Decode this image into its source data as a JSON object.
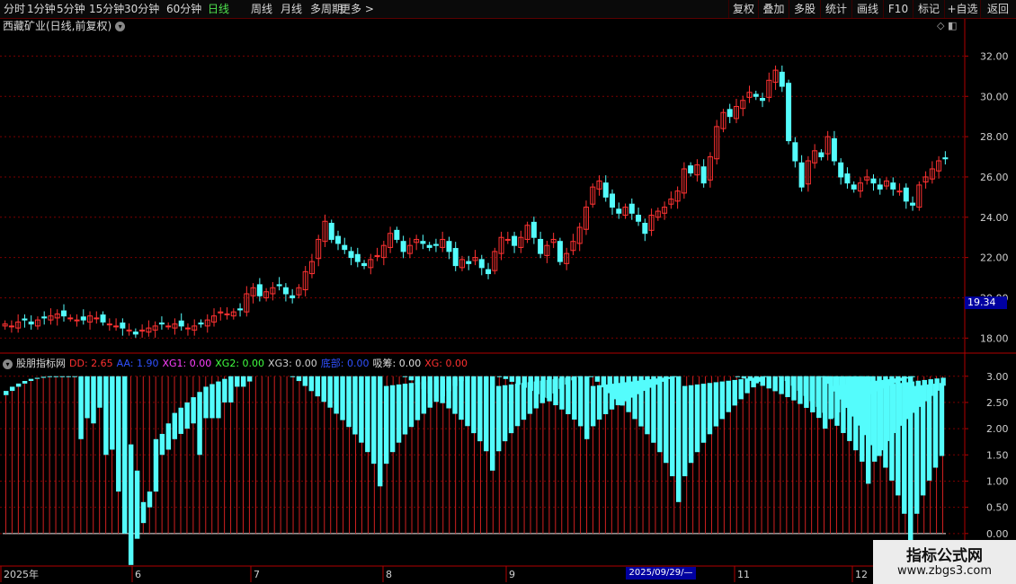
{
  "toolbar": {
    "periods": [
      "分时",
      "1分钟",
      "5分钟",
      "15分钟",
      "30分钟",
      "60分钟",
      "日线",
      "周线",
      "月线",
      "多周期",
      "更多 >"
    ],
    "active_period": "日线",
    "right_buttons": [
      "复权",
      "叠加",
      "多股",
      "统计",
      "画线",
      "F10",
      "标记",
      "+自选",
      "返回"
    ]
  },
  "chart_title": "西藏矿业(日线,前复权)",
  "price_badge": "19.34",
  "date_badge": "2025/09/29/—",
  "indicator": {
    "name": "股朋指标网",
    "values": [
      {
        "label": "DD: 2.65",
        "color": "#ff3030"
      },
      {
        "label": "AA: 1.90",
        "color": "#3050ff"
      },
      {
        "label": "XG1: 0.00",
        "color": "#ff40ff"
      },
      {
        "label": "XG2: 0.00",
        "color": "#40ff40"
      },
      {
        "label": "XG3: 0.00",
        "color": "#d0d0d0"
      },
      {
        "label": "底部: 0.00",
        "color": "#3050ff"
      },
      {
        "label": "吸筹: 0.00",
        "color": "#e0e0e0"
      },
      {
        "label": "XG: 0.00",
        "color": "#ff3030"
      }
    ]
  },
  "watermark": {
    "line1": "指标公式网",
    "line2": "www.zbgs3.com"
  },
  "colors": {
    "up": "#ff3232",
    "down": "#54fcfc",
    "grid": "#7a0000",
    "axis": "#b00000"
  },
  "chart_data": [
    {
      "type": "candlestick",
      "price_ticks": [
        "32.00",
        "30.00",
        "28.00",
        "26.00",
        "24.00",
        "22.00",
        "20.00",
        "18.00"
      ],
      "ylim": [
        17.3,
        33.0
      ],
      "x_labels": [
        "2025年",
        "6",
        "7",
        "8",
        "9",
        "11",
        "12"
      ],
      "close": [
        18.7,
        18.6,
        18.8,
        18.9,
        18.7,
        18.9,
        19.0,
        19.1,
        19.2,
        19.1,
        19.0,
        18.9,
        18.9,
        19.1,
        19.0,
        18.8,
        18.7,
        18.6,
        18.5,
        18.4,
        18.2,
        18.4,
        18.5,
        18.6,
        18.7,
        18.6,
        18.7,
        18.6,
        18.5,
        18.6,
        18.7,
        18.9,
        19.1,
        19.3,
        19.2,
        19.3,
        19.4,
        20.2,
        20.5,
        20.1,
        20.3,
        20.5,
        20.6,
        20.2,
        20.0,
        20.5,
        21.3,
        21.8,
        22.9,
        23.8,
        22.9,
        22.7,
        22.4,
        22.0,
        21.8,
        21.6,
        21.9,
        22.1,
        22.6,
        23.2,
        22.9,
        22.3,
        22.6,
        22.9,
        22.7,
        22.5,
        22.6,
        22.9,
        22.3,
        21.6,
        21.9,
        21.7,
        22.0,
        21.5,
        21.2,
        22.3,
        23.0,
        22.9,
        22.6,
        23.0,
        23.6,
        23.0,
        22.2,
        22.6,
        22.9,
        21.8,
        22.2,
        22.8,
        23.5,
        24.5,
        25.5,
        25.8,
        25.0,
        24.5,
        24.2,
        24.5,
        24.2,
        23.8,
        23.2,
        24.1,
        24.3,
        24.5,
        24.9,
        25.3,
        26.4,
        26.2,
        26.6,
        25.7,
        27.0,
        28.5,
        29.2,
        29.0,
        29.5,
        29.8,
        30.2,
        30.0,
        29.8,
        30.8,
        31.3,
        30.5,
        27.8,
        26.8,
        25.5,
        26.8,
        27.3,
        27.0,
        28.0,
        26.8,
        26.0,
        25.7,
        25.4,
        25.7,
        26.0,
        25.7,
        25.4,
        25.8,
        25.4,
        25.3,
        24.8,
        24.6,
        25.6,
        26.0,
        26.4,
        26.8,
        26.9
      ]
    },
    {
      "type": "bar",
      "ylabels": [
        "3.00",
        "2.50",
        "2.00",
        "1.50",
        "1.00",
        "0.50",
        "0.00"
      ],
      "ylim": [
        -0.62,
        3.15
      ],
      "red_bars": [
        2.64,
        2.72,
        2.8,
        2.86,
        2.91,
        2.95,
        2.97,
        2.99,
        3.0,
        3.0,
        3.0,
        3.0,
        3.0,
        3.0,
        3.0,
        3.0,
        3.0,
        3.0,
        3.0,
        3.0,
        3.0,
        3.0,
        3.0,
        3.0,
        3.0,
        3.0,
        3.0,
        3.0,
        3.0,
        3.0,
        3.0,
        3.0,
        3.0,
        3.0,
        3.0,
        3.0,
        3.0,
        3.0,
        3.0,
        3.0,
        3.0,
        3.0,
        3.0,
        3.0,
        3.0,
        3.0,
        3.0,
        3.0,
        3.0,
        3.0,
        3.0,
        3.0,
        3.0,
        3.0,
        3.0,
        3.0,
        3.0,
        3.0,
        3.0,
        3.0,
        3.0,
        3.0,
        3.0,
        3.0,
        3.0,
        3.0,
        3.0,
        3.0,
        3.0,
        3.0,
        3.0,
        3.0,
        3.0,
        3.0,
        3.0,
        3.0,
        3.0,
        3.0,
        3.0,
        3.0,
        3.0,
        3.0,
        3.0,
        3.0,
        3.0,
        3.0,
        3.0,
        3.0,
        3.0,
        3.0,
        3.0,
        3.0,
        3.0,
        3.0,
        3.0,
        3.0,
        3.0,
        3.0,
        3.0,
        3.0,
        3.0,
        3.0,
        3.0,
        3.0,
        3.0,
        3.0,
        3.0,
        3.0,
        3.0,
        3.0,
        3.0,
        3.0,
        3.0,
        3.0,
        3.0,
        3.0,
        3.0,
        3.0,
        3.0,
        3.0,
        3.0,
        3.0,
        3.0,
        3.0,
        3.0,
        3.0,
        3.0,
        3.0,
        3.0,
        3.0,
        3.0,
        3.0,
        3.0,
        3.0,
        3.0,
        3.0,
        3.0,
        3.0,
        3.0,
        3.0,
        3.0,
        3.0,
        3.0,
        3.0,
        3.0,
        3.0,
        3.0,
        3.0,
        3.0,
        3.0,
        3.0
      ],
      "cyan_bars": [
        [
          2.64,
          2.72
        ],
        [
          2.72,
          2.8
        ],
        [
          2.8,
          2.86
        ],
        [
          2.86,
          2.91
        ],
        [
          2.91,
          2.95
        ],
        [
          2.95,
          2.97
        ],
        [
          2.97,
          2.99
        ],
        [
          2.99,
          3.0
        ],
        [
          3.0,
          3.0
        ],
        [
          3.0,
          3.0
        ],
        [
          3.0,
          3.0
        ],
        [
          3.0,
          3.0
        ],
        [
          3.0,
          1.8
        ],
        [
          3.0,
          2.2
        ],
        [
          3.0,
          2.1
        ],
        [
          3.0,
          2.4
        ],
        [
          3.0,
          1.5
        ],
        [
          3.0,
          1.6
        ],
        [
          3.0,
          0.8
        ],
        [
          3.0,
          0.0
        ],
        [
          1.7,
          -0.6
        ],
        [
          1.2,
          -0.1
        ],
        [
          0.6,
          0.2
        ],
        [
          0.8,
          0.5
        ],
        [
          1.8,
          0.8
        ],
        [
          1.9,
          1.5
        ],
        [
          2.1,
          1.6
        ],
        [
          2.3,
          1.8
        ],
        [
          2.4,
          1.9
        ],
        [
          2.5,
          2.0
        ],
        [
          2.6,
          2.1
        ],
        [
          2.7,
          1.5
        ],
        [
          2.8,
          2.2
        ],
        [
          2.85,
          2.2
        ],
        [
          2.9,
          2.2
        ],
        [
          2.95,
          2.5
        ],
        [
          3.0,
          2.5
        ],
        [
          3.0,
          2.8
        ],
        [
          3.0,
          2.8
        ],
        [
          3.0,
          2.9
        ]
      ]
    }
  ]
}
